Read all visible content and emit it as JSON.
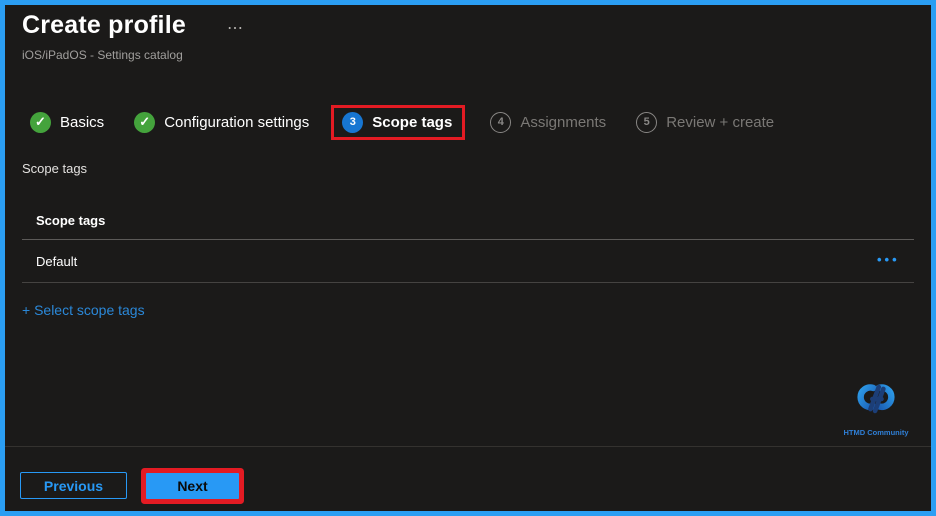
{
  "header": {
    "title": "Create profile",
    "more_menu_glyph": "⋯",
    "subtitle": "iOS/iPadOS - Settings catalog"
  },
  "wizard": {
    "check_glyph": "✓",
    "steps": [
      {
        "label": "Basics",
        "state": "complete"
      },
      {
        "label": "Configuration settings",
        "state": "complete"
      },
      {
        "label": "Scope tags",
        "state": "current",
        "number": "3",
        "highlighted": true
      },
      {
        "label": "Assignments",
        "state": "upcoming",
        "number": "4"
      },
      {
        "label": "Review + create",
        "state": "upcoming",
        "number": "5"
      }
    ]
  },
  "content": {
    "section_label": "Scope tags",
    "table": {
      "header": "Scope tags",
      "rows": [
        {
          "value": "Default",
          "menu_glyph": "•••"
        }
      ]
    },
    "add_link_label": "+ Select scope tags"
  },
  "branding": {
    "name": "HTMD Community"
  },
  "footer": {
    "previous_label": "Previous",
    "next_label": "Next"
  },
  "colors": {
    "background": "#1b1a19",
    "frame_accent": "#2b9ef3",
    "highlight_red": "#e31b23",
    "step_complete_green": "#44a33c",
    "step_current_blue": "#1776d2",
    "link_blue": "#2b88d8",
    "button_blue": "#2899f5"
  }
}
